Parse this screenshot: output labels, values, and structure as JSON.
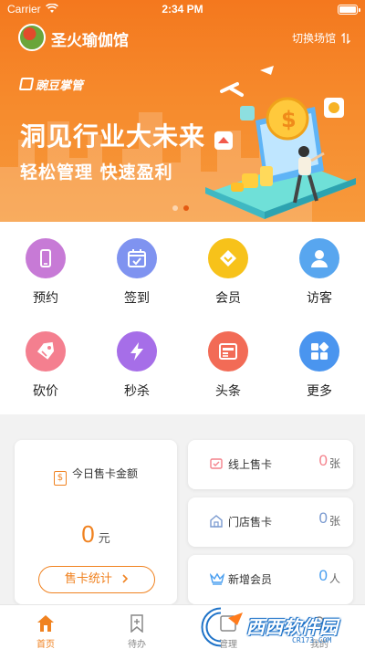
{
  "status_bar": {
    "carrier": "Carrier",
    "time": "2:34 PM"
  },
  "header": {
    "venue_name": "圣火瑜伽馆",
    "switch_label": "切换场馆"
  },
  "banner": {
    "brand": "豌豆掌管",
    "headline": "洞见行业大未来",
    "subline": "轻松管理  快速盈利",
    "slides": 2,
    "active_slide": 2
  },
  "menu": {
    "items": [
      {
        "label": "预约",
        "icon": "phone-icon",
        "color": "#c77ad6"
      },
      {
        "label": "签到",
        "icon": "calendar-check-icon",
        "color": "#7f93f0"
      },
      {
        "label": "会员",
        "icon": "vip-diamond-icon",
        "color": "#f7c21a"
      },
      {
        "label": "访客",
        "icon": "user-icon",
        "color": "#58a6ef"
      },
      {
        "label": "砍价",
        "icon": "price-tag-icon",
        "color": "#f47f8f"
      },
      {
        "label": "秒杀",
        "icon": "lightning-icon",
        "color": "#a66ee8"
      },
      {
        "label": "头条",
        "icon": "news-icon",
        "color": "#f26b56"
      },
      {
        "label": "更多",
        "icon": "grid-icon",
        "color": "#4a95ef"
      }
    ]
  },
  "stats": {
    "today_sales_title": "今日售卡金额",
    "today_sales_amount": "0",
    "today_sales_unit": "元",
    "sales_stats_button": "售卡统计",
    "cards": [
      {
        "label": "线上售卡",
        "value": "0",
        "unit": "张",
        "color": "#f4828c"
      },
      {
        "label": "门店售卡",
        "value": "0",
        "unit": "张",
        "color": "#7a9ad0"
      },
      {
        "label": "新增会员",
        "value": "0",
        "unit": "人",
        "color": "#4a9ff0"
      }
    ]
  },
  "tabbar": {
    "tabs": [
      {
        "label": "首页",
        "active": true
      },
      {
        "label": "待办",
        "active": false
      },
      {
        "label": "管理",
        "active": false
      },
      {
        "label": "我的",
        "active": false
      }
    ]
  },
  "watermark": {
    "text": "西西软件园",
    "url": "CR173.COM"
  },
  "colors": {
    "accent": "#f08220",
    "banner": "#f4781e"
  }
}
